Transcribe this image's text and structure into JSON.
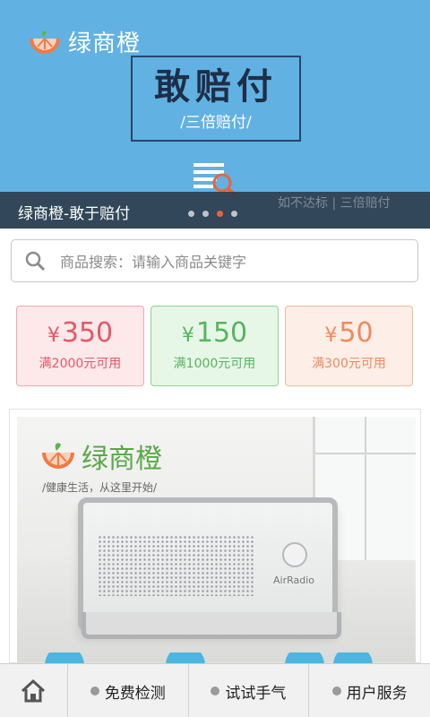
{
  "banner": {
    "logo_text": "绿商橙",
    "headline": "敢赔付",
    "subline": "/三倍赔付/",
    "caption": "绿商橙-敢于赔付",
    "caption_right": "如不达标 | 三倍赔付",
    "slides_total": 4,
    "active_slide": 3
  },
  "search": {
    "placeholder": "商品搜索：请输入商品关键字"
  },
  "coupons": [
    {
      "currency": "¥",
      "amount": "350",
      "condition": "满2000元可用",
      "color": "#e45866"
    },
    {
      "currency": "¥",
      "amount": "150",
      "condition": "满1000元可用",
      "color": "#55b55c"
    },
    {
      "currency": "¥",
      "amount": "50",
      "condition": "满300元可用",
      "color": "#ee8a5d"
    }
  ],
  "product": {
    "logo_text": "绿商橙",
    "slogan": "/健康生活，从这里开始/",
    "device_brand": "AirRadio"
  },
  "nav": {
    "home_icon": "home-icon",
    "items": [
      {
        "label": "免费检测"
      },
      {
        "label": "试试手气"
      },
      {
        "label": "用户服务"
      }
    ]
  },
  "colors": {
    "banner_bg": "#62b1e3",
    "accent_orange": "#e8643c",
    "brand_green": "#5aa848"
  }
}
